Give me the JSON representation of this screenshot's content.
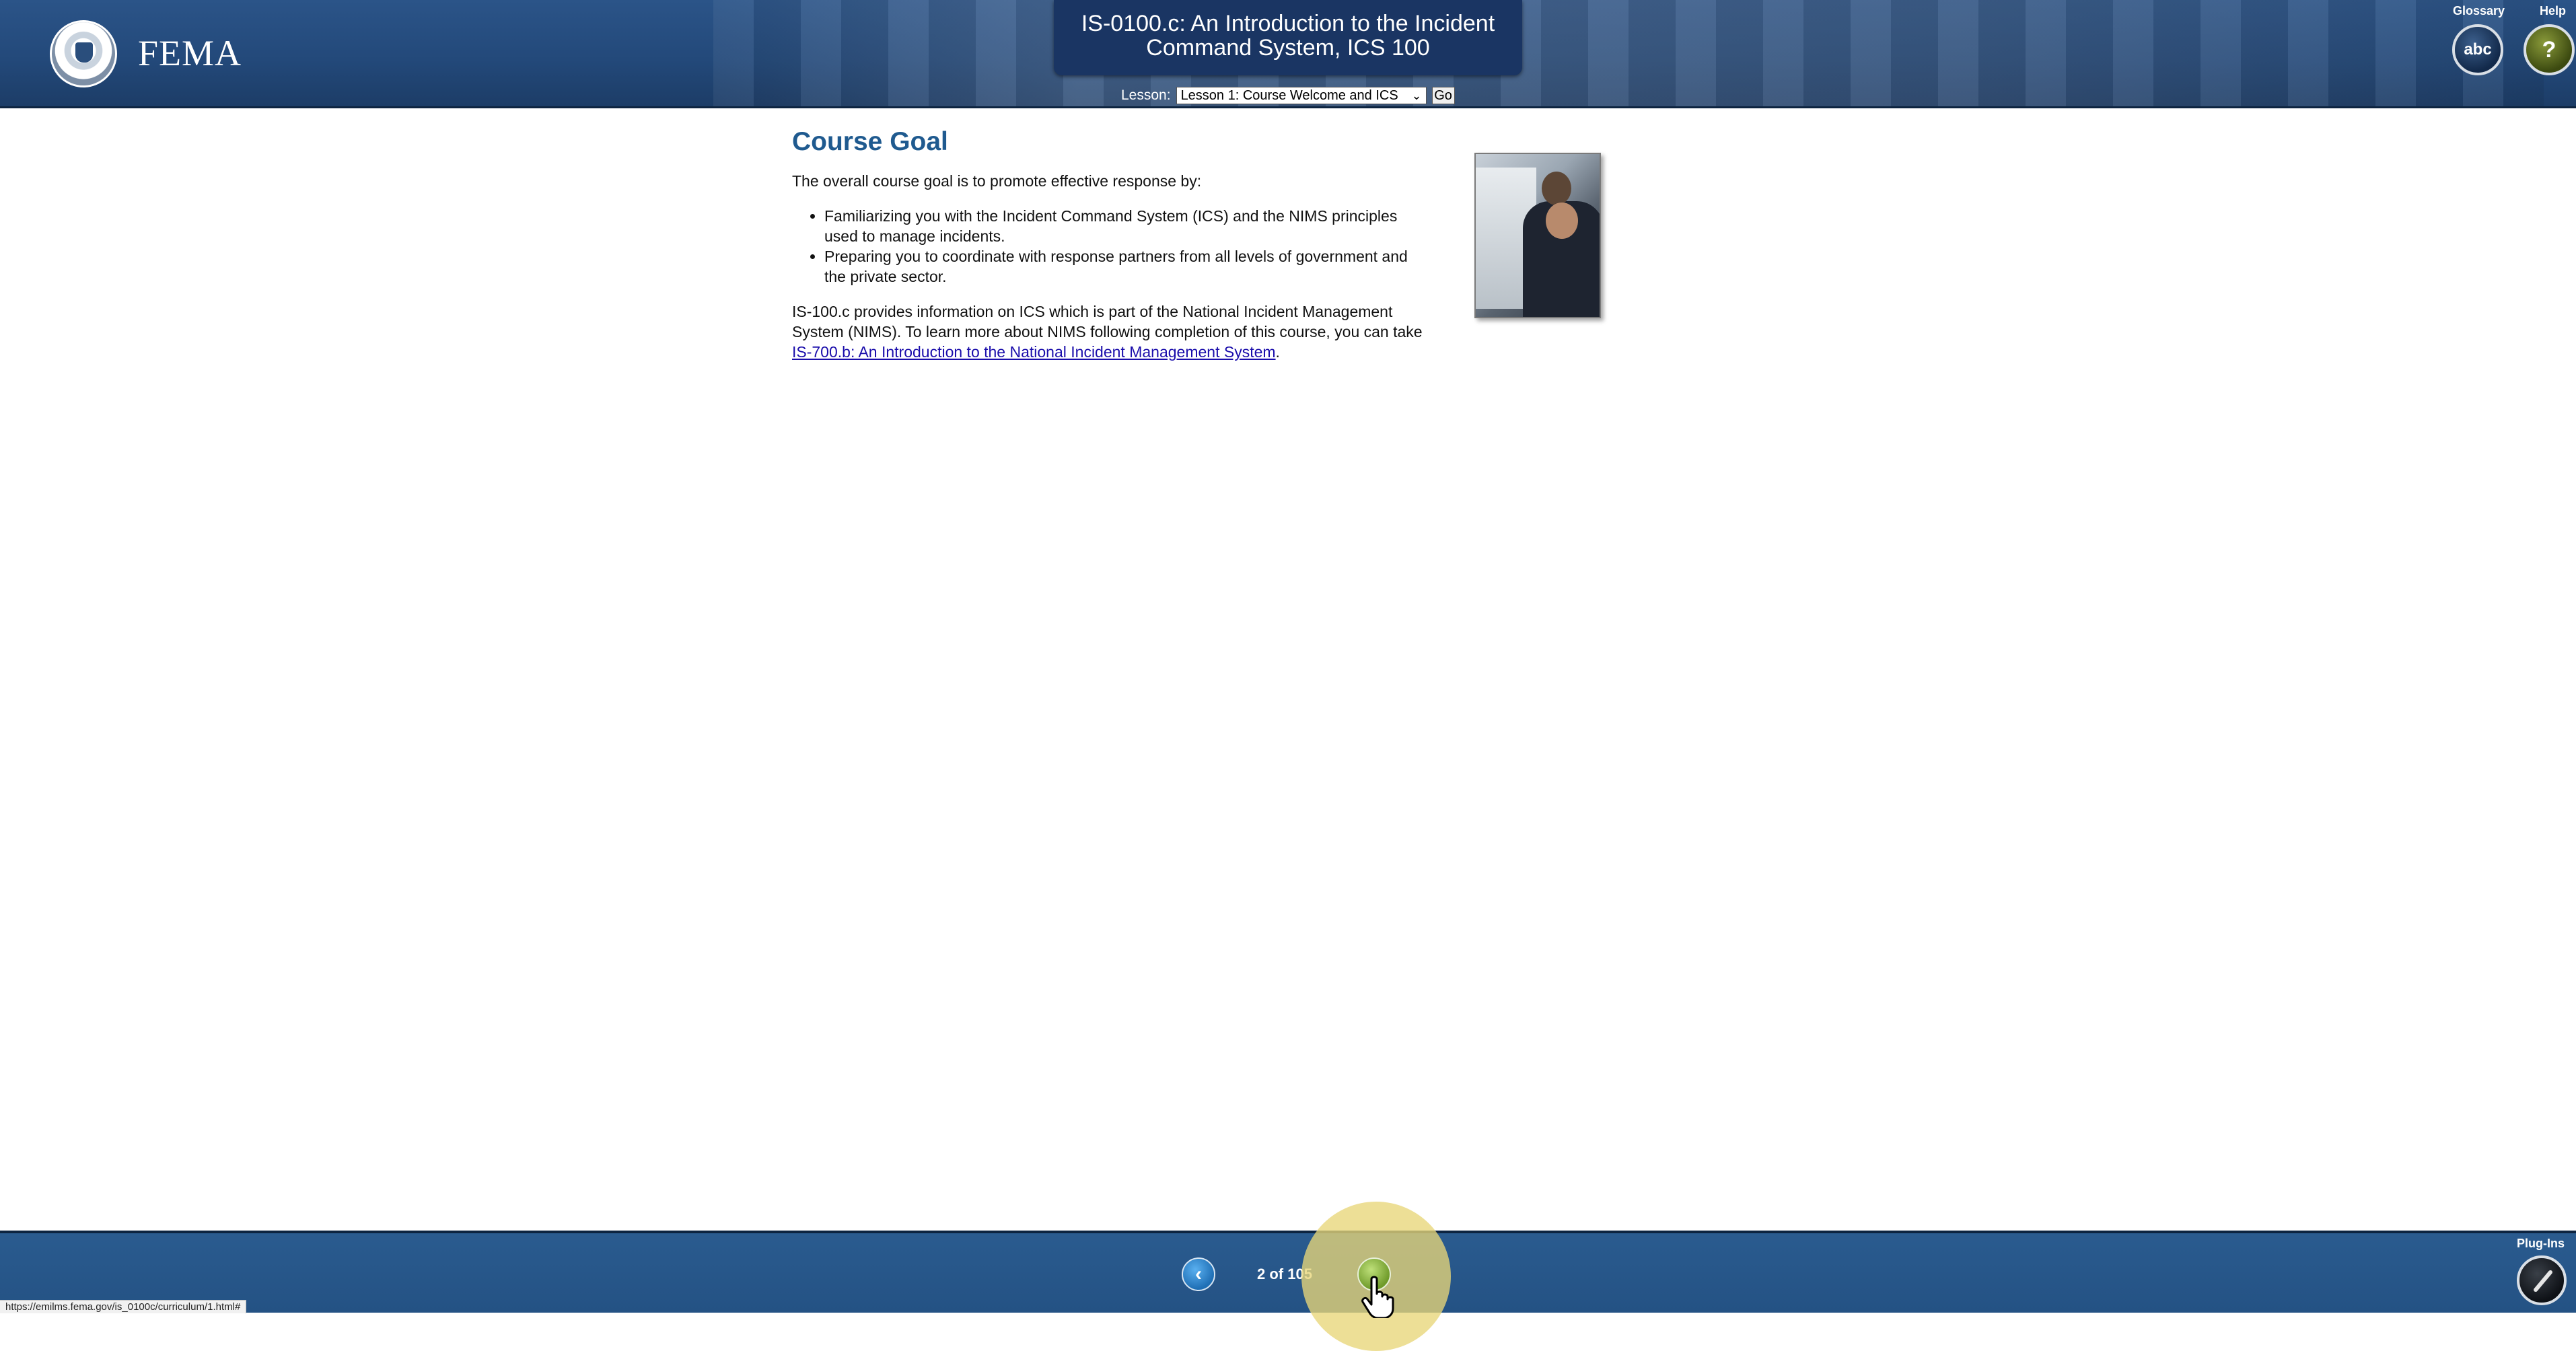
{
  "header": {
    "brand": "FEMA",
    "course_title_line1": "IS-0100.c: An Introduction to the Incident",
    "course_title_line2": "Command System, ICS 100",
    "lesson_label": "Lesson:",
    "lesson_selected": "Lesson 1: Course Welcome and ICS",
    "go_label": "Go",
    "glossary_label": "Glossary",
    "glossary_button": "abc",
    "help_label": "Help",
    "help_button": "?"
  },
  "main": {
    "title": "Course Goal",
    "intro": "The overall course goal is to promote effective response by:",
    "bullets": [
      "Familiarizing you with the Incident Command System (ICS) and the NIMS principles used to manage incidents.",
      "Preparing you to coordinate with response partners from all levels of government and the private sector."
    ],
    "body_text": "IS-100.c provides information on ICS which is part of the National Incident Management System (NIMS). To learn more about NIMS following completion of this course, you can take ",
    "link_text": "IS-700.b: An Introduction to the National Incident Management System",
    "body_end": "."
  },
  "footer": {
    "page_indicator": "2 of 105",
    "current_page": 2,
    "total_pages": 105,
    "plugins_label": "Plug-Ins"
  },
  "status_bar": {
    "url": "https://emilms.fema.gov/is_0100c/curriculum/1.html#"
  },
  "icons": [
    "dhs-seal-icon",
    "glossary-icon",
    "help-icon",
    "back-arrow-icon",
    "next-arrow-icon",
    "hand-cursor-icon",
    "plugins-icon"
  ]
}
